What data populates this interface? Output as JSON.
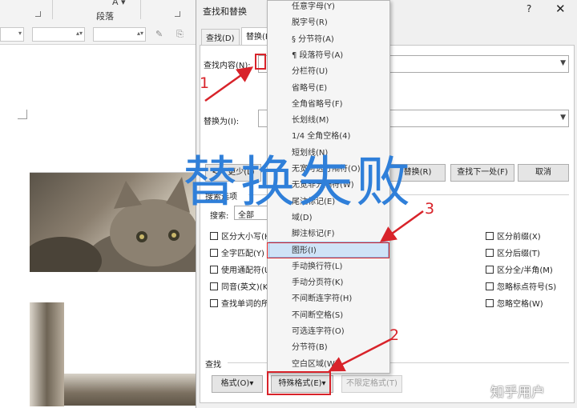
{
  "ribbon": {
    "group_label": "段落"
  },
  "dialog": {
    "title": "查找和替换",
    "help": "?",
    "close": "✕",
    "tabs": [
      {
        "label": "查找(D)"
      },
      {
        "label": "替换(P)"
      }
    ],
    "find_label": "查找内容(N):",
    "replace_label": "替换为(I):",
    "more_options_label": "搜索选项",
    "search_label": "搜索:",
    "search_value": "全部",
    "buttons": {
      "replace": "替换(R)",
      "find_next": "查找下一处(F)",
      "cancel": "取消",
      "more": "<< 更少(L)"
    },
    "checkboxes_left": [
      "区分大小写(H)",
      "全字匹配(Y)",
      "使用通配符(U)",
      "同音(英文)(K)",
      "查找单词的所有形式(英文)(W)"
    ],
    "checkboxes_right": [
      "区分前缀(X)",
      "区分后缀(T)",
      "区分全/半角(M)",
      "忽略标点符号(S)",
      "忽略空格(W)"
    ],
    "find_section": "查找",
    "format_button": "格式(O)▾",
    "special_button": "特殊格式(E)▾",
    "no_format_button": "不限定格式(T)"
  },
  "menu": {
    "items": [
      "任意字母(Y)",
      "脱字号(R)",
      "§ 分节符(A)",
      "¶ 段落符号(A)",
      "分栏符(U)",
      "省略号(E)",
      "全角省略号(F)",
      "长划线(M)",
      "1/4 全角空格(4)",
      "短划线(N)",
      "无宽可选分隔符(O)",
      "无宽非分隔符(W)",
      "尾注标记(E)",
      "域(D)",
      "脚注标记(F)",
      "图形(I)",
      "手动换行符(L)",
      "手动分页符(K)",
      "不间断连字符(H)",
      "不间断空格(S)",
      "可选连字符(O)",
      "分节符(B)",
      "空白区域(W)"
    ],
    "highlighted_index": 15
  },
  "annotations": {
    "overlay_text": "替换失败",
    "num1": "1",
    "num2": "2",
    "num3": "3",
    "color": "#d8232a"
  },
  "watermark": "知乎用户"
}
